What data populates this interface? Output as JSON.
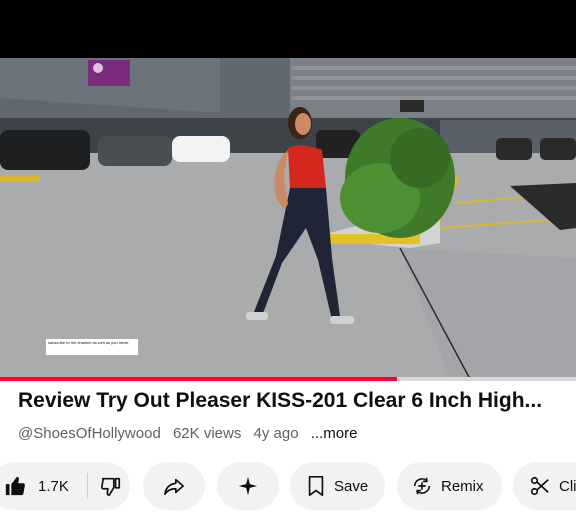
{
  "video": {
    "title": "Review Try Out Pleaser KISS-201 Clear 6 Inch High...",
    "subtitle_caption": "subscribe to the channel as well as you never",
    "progress_fraction": 0.69
  },
  "meta": {
    "channel": "@ShoesOfHollywood",
    "views": "62K views",
    "age": "4y ago",
    "more": "...more"
  },
  "actions": {
    "like_count": "1.7K",
    "save_label": "Save",
    "remix_label": "Remix",
    "clip_label": "Cli"
  },
  "colors": {
    "progress": "#ff0033",
    "pill_bg": "#f2f2f2"
  }
}
